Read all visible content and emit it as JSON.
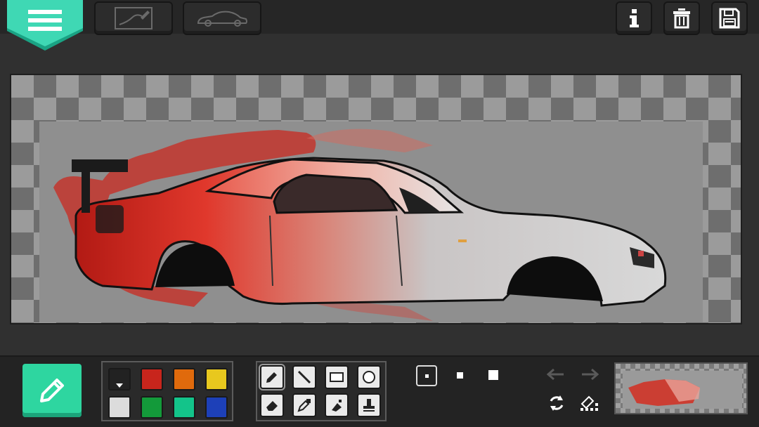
{
  "app": {
    "top_buttons": {
      "menu": "menu-icon",
      "sketch_tab": "sketch-icon",
      "car_tab": "car-silhouette-icon",
      "info": "info-icon",
      "delete": "trash-icon",
      "save": "save-icon"
    },
    "accent_color": "#2ed6a0"
  },
  "palette": {
    "colors": [
      "#222222",
      "#c8251c",
      "#e06a0c",
      "#e8c81e",
      "#dcdcdc",
      "#139a3a",
      "#13c48a",
      "#1d40b8"
    ],
    "selected_index": 0
  },
  "tools": {
    "items": [
      "pencil",
      "line",
      "rectangle",
      "circle",
      "eraser",
      "eyedropper",
      "fill-bucket",
      "stamp"
    ],
    "active": "pencil"
  },
  "brush_sizes": {
    "options": [
      "small",
      "medium",
      "large"
    ],
    "selected": "small"
  },
  "history": {
    "undo": "undo-icon",
    "redo": "redo-icon",
    "rotate": "rotate-icon",
    "clear_grid": "clear-grid-icon"
  }
}
